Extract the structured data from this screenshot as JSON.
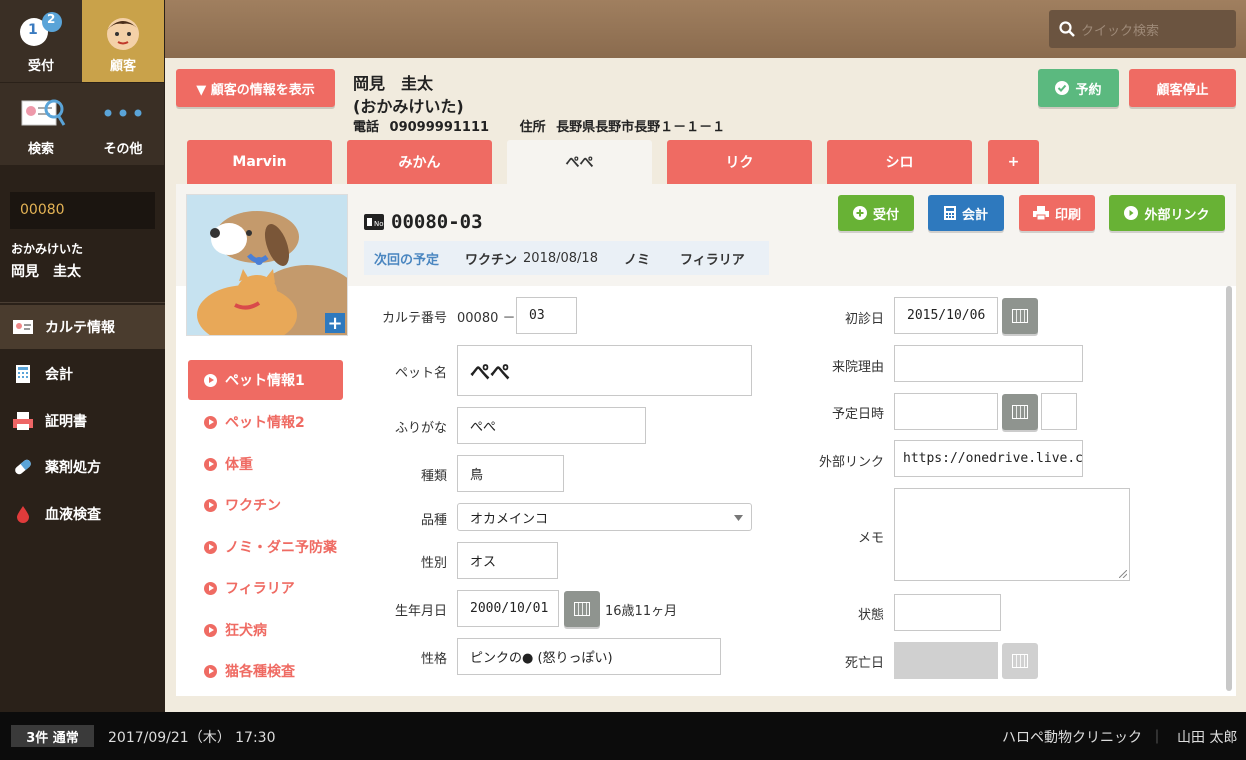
{
  "sidebar": {
    "reception_label": "受付",
    "reception_badge_1": "1",
    "reception_badge_2": "2",
    "customer_label": "顧客",
    "search_label": "検索",
    "other_label": "その他",
    "customer_id": "00080",
    "customer_kana": "おかみけいた",
    "customer_name": "岡見　圭太",
    "menu": [
      {
        "label": "カルテ情報"
      },
      {
        "label": "会計"
      },
      {
        "label": "証明書"
      },
      {
        "label": "薬剤処方"
      },
      {
        "label": "血液検査"
      }
    ]
  },
  "topbar": {
    "quick_search_placeholder": "クイック検索"
  },
  "customer": {
    "show_info_button": "▼ 顧客の情報を表示",
    "name": "岡見　圭太",
    "kana": "(おかみけいた)",
    "phone_label": "電話",
    "phone": "09099991111",
    "address_label": "住所",
    "address": "長野県長野市長野１－１－１",
    "reserve_button": "予約",
    "stop_button": "顧客停止"
  },
  "tabs": [
    {
      "label": "Marvin"
    },
    {
      "label": "みかん"
    },
    {
      "label": "ぺぺ"
    },
    {
      "label": "リク"
    },
    {
      "label": "シロ"
    },
    {
      "label": "+"
    }
  ],
  "pet": {
    "chart_no": "00080-03",
    "schedule_label": "次回の予定",
    "schedule_vaccine": "ワクチン",
    "schedule_date": "2018/08/18",
    "schedule_flea": "ノミ",
    "schedule_filaria": "フィラリア",
    "actions": {
      "reception": "受付",
      "accounting": "会計",
      "print": "印刷",
      "external_link": "外部リンク"
    }
  },
  "petnav": [
    {
      "label": "ペット情報1"
    },
    {
      "label": "ペット情報2"
    },
    {
      "label": "体重"
    },
    {
      "label": "ワクチン"
    },
    {
      "label": "ノミ・ダニ予防薬"
    },
    {
      "label": "フィラリア"
    },
    {
      "label": "狂犬病"
    },
    {
      "label": "猫各種検査"
    }
  ],
  "form": {
    "chart_label": "カルテ番号",
    "chart_prefix": "00080 －",
    "chart_suffix": "03",
    "name_label": "ペット名",
    "name": "ぺぺ",
    "furigana_label": "ふりがな",
    "furigana": "ぺぺ",
    "species_label": "種類",
    "species": "鳥",
    "breed_label": "品種",
    "breed": "オカメインコ",
    "sex_label": "性別",
    "sex": "オス",
    "birth_label": "生年月日",
    "birth": "2000/10/01",
    "age": "16歳11ヶ月",
    "character_label": "性格",
    "character": "ピンクの● (怒りっぽい)",
    "first_visit_label": "初診日",
    "first_visit": "2015/10/06",
    "reason_label": "来院理由",
    "reason": "",
    "scheduled_label": "予定日時",
    "ext_link_label": "外部リンク",
    "ext_link": "https://onedrive.live.com/",
    "memo_label": "メモ",
    "status_label": "状態",
    "death_label": "死亡日"
  },
  "statusbar": {
    "badge": "3件 通常",
    "datetime": "2017/09/21（木） 17:30",
    "clinic": "ハロペ動物クリニック",
    "divider": "｜",
    "user": "山田 太郎"
  }
}
